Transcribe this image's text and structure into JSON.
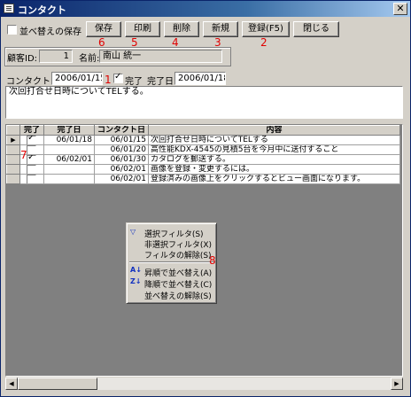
{
  "window": {
    "title": "コンタクト",
    "close_glyph": "✕"
  },
  "toolbar": {
    "sort_save_label": "並べ替えの保存",
    "save_label": "保存",
    "print_label": "印刷",
    "delete_label": "削除",
    "new_label": "新規",
    "register_label": "登録(F5)",
    "close_label": "閉じる"
  },
  "annotations": [
    "1",
    "2",
    "3",
    "4",
    "5",
    "6",
    "7",
    "8"
  ],
  "customer": {
    "id_label": "顧客ID:",
    "id_value": "1",
    "name_label": "名前:",
    "name_value": "南山 統一"
  },
  "contact": {
    "date_label": "コンタクト日",
    "date_value": "2006/01/15",
    "done_label": "完了",
    "done_checked": true,
    "done_date_label": "完了日",
    "done_date_value": "2006/01/18",
    "note": "次回打合せ日時についてTELする。"
  },
  "grid": {
    "headers": [
      "完了",
      "完了日",
      "コンタクト日",
      "内容"
    ],
    "rows": [
      {
        "selected": true,
        "done": true,
        "done_date": "06/01/18",
        "contact_date": "06/01/15",
        "content": "次回打合せ日時についてTELする"
      },
      {
        "selected": false,
        "done": false,
        "done_date": "",
        "contact_date": "06/01/20",
        "content": "高性能KDX-4545の見積5台を今月中に送付すること"
      },
      {
        "selected": false,
        "done": true,
        "done_date": "06/02/01",
        "contact_date": "06/01/30",
        "content": "カタログを郵送する。"
      },
      {
        "selected": false,
        "done": false,
        "done_date": "",
        "contact_date": "06/02/01",
        "content": "画像を登録・変更するには。"
      },
      {
        "selected": false,
        "done": false,
        "done_date": "",
        "contact_date": "06/02/01",
        "content": "登録済みの画像上をクリックするとビュー画面になります。"
      }
    ]
  },
  "context_menu": {
    "items": [
      "選択フィルタ(S)",
      "非選択フィルタ(X)",
      "フィルタの解除(S)",
      "昇順で並べ替え(A)",
      "降順で並べ替え(C)",
      "並べ替えの解除(S)"
    ],
    "icons": [
      "filter-icon",
      "sort-asc-icon",
      "sort-desc-icon"
    ]
  },
  "scrollbar": {
    "left_glyph": "◀",
    "right_glyph": "▶"
  }
}
